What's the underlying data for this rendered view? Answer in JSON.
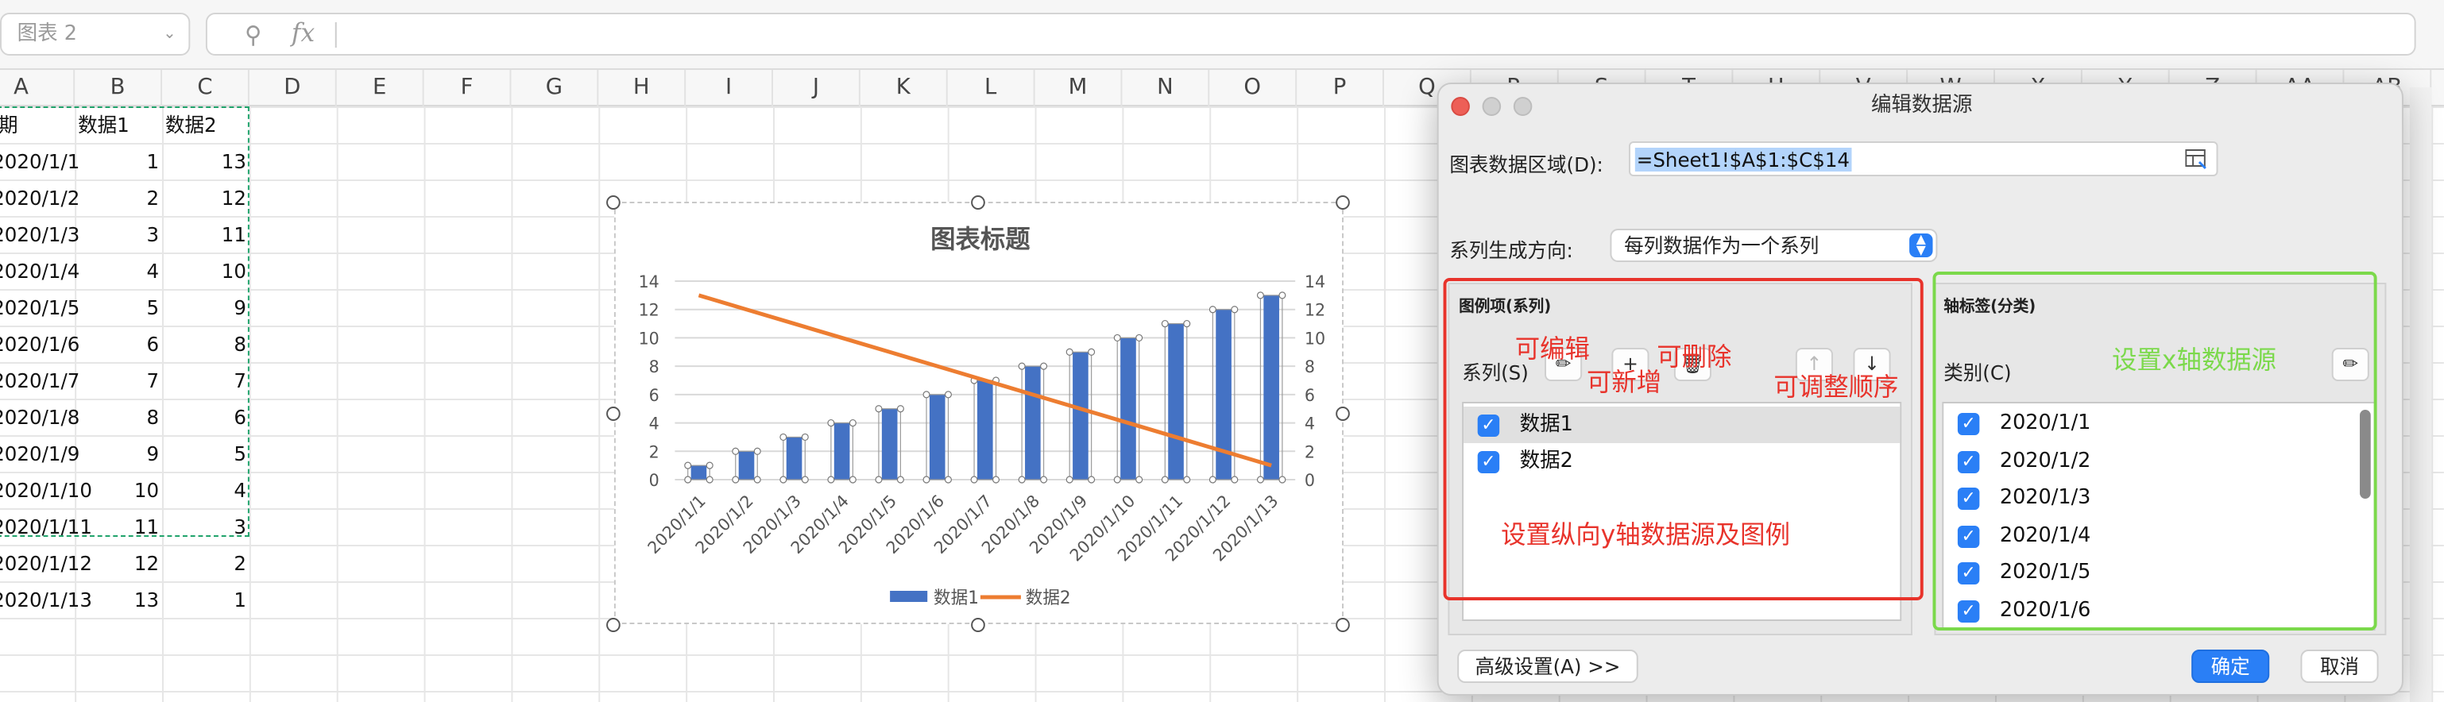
{
  "namebox": {
    "value": "图表 2"
  },
  "formula_bar": {
    "search_icon": "search-icon",
    "fx_label": "fx"
  },
  "columns": [
    "A",
    "B",
    "C",
    "D",
    "E",
    "F",
    "G",
    "H",
    "I",
    "J",
    "K",
    "L",
    "M",
    "N",
    "O",
    "P",
    "Q",
    "R",
    "S",
    "T",
    "U",
    "V",
    "W",
    "X",
    "Y",
    "Z",
    "AA",
    "AB"
  ],
  "sheet": {
    "header": [
      "期",
      "数据1",
      "数据2"
    ],
    "rows": [
      [
        "2020/1/1",
        "1",
        "13"
      ],
      [
        "2020/1/2",
        "2",
        "12"
      ],
      [
        "2020/1/3",
        "3",
        "11"
      ],
      [
        "2020/1/4",
        "4",
        "10"
      ],
      [
        "2020/1/5",
        "5",
        "9"
      ],
      [
        "2020/1/6",
        "6",
        "8"
      ],
      [
        "2020/1/7",
        "7",
        "7"
      ],
      [
        "2020/1/8",
        "8",
        "6"
      ],
      [
        "2020/1/9",
        "9",
        "5"
      ],
      [
        "2020/1/10",
        "10",
        "4"
      ],
      [
        "2020/1/11",
        "11",
        "3"
      ],
      [
        "2020/1/12",
        "12",
        "2"
      ],
      [
        "2020/1/13",
        "13",
        "1"
      ]
    ]
  },
  "chart_data": {
    "type": "bar",
    "title": "图表标题",
    "categories": [
      "2020/1/1",
      "2020/1/2",
      "2020/1/3",
      "2020/1/4",
      "2020/1/5",
      "2020/1/6",
      "2020/1/7",
      "2020/1/8",
      "2020/1/9",
      "2020/1/10",
      "2020/1/11",
      "2020/1/12",
      "2020/1/13"
    ],
    "series": [
      {
        "name": "数据1",
        "type": "bar",
        "color": "#4472c4",
        "values": [
          1,
          2,
          3,
          4,
          5,
          6,
          7,
          8,
          9,
          10,
          11,
          12,
          13
        ]
      },
      {
        "name": "数据2",
        "type": "line",
        "color": "#ed7d31",
        "values": [
          13,
          12,
          11,
          10,
          9,
          8,
          7,
          6,
          5,
          4,
          3,
          2,
          1
        ]
      }
    ],
    "y_ticks": [
      "0",
      "2",
      "4",
      "6",
      "8",
      "10",
      "12",
      "14"
    ],
    "ylim": [
      0,
      14
    ],
    "legend": "bottom",
    "grid": true
  },
  "dialog": {
    "title": "编辑数据源",
    "range_label": "图表数据区域(D):",
    "range_value": "=Sheet1!$A$1:$C$14",
    "direction_label": "系列生成方向:",
    "direction_value": "每列数据作为一个系列",
    "legend_panel_title": "图例项(系列)",
    "series_label": "系列(S)",
    "series_items": [
      "数据1",
      "数据2"
    ],
    "axis_panel_title": "轴标签(分类)",
    "category_label": "类别(C)",
    "category_items": [
      "2020/1/1",
      "2020/1/2",
      "2020/1/3",
      "2020/1/4",
      "2020/1/5",
      "2020/1/6"
    ],
    "advanced_button": "高级设置(A) >>",
    "ok_button": "确定",
    "cancel_button": "取消",
    "colors": {
      "accent": "#2a7ff6",
      "close": "#ed5f57",
      "inactive": "#cfcfcf"
    }
  },
  "annotations": {
    "edit": "可编辑",
    "add": "可新增",
    "delete": "可删除",
    "reorder": "可调整顺序",
    "y_axis": "设置纵向y轴数据源及图例",
    "x_axis": "设置x轴数据源",
    "red": "#e8332b",
    "green_text": "#7bd94b"
  }
}
